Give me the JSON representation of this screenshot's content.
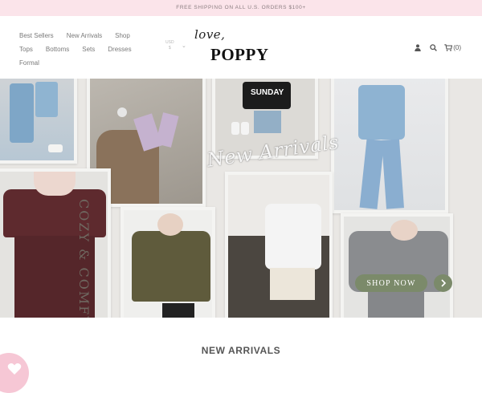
{
  "announcement": "FREE SHIPPING ON ALL U.S. ORDERS $100+",
  "nav": {
    "row1": [
      "Best Sellers",
      "New Arrivals",
      "Shop"
    ],
    "row2": [
      "Tops",
      "Bottoms",
      "Sets",
      "Dresses"
    ],
    "row3": [
      "Formal"
    ]
  },
  "currency": {
    "label": "USD",
    "value": "$"
  },
  "logo": {
    "love": "love,",
    "brand": "POPPY"
  },
  "cart": {
    "count": "(0)"
  },
  "hero": {
    "caption": "New Arrivals",
    "side_text": "COZY & COMFY",
    "cta": "SHOP NOW",
    "sweatshirt_text": "SUNDAY"
  },
  "section_title": "NEW ARRIVALS",
  "colors": {
    "announcement_bg": "#fbe4ea",
    "cta_green": "#7b8a6a",
    "heart_pink": "#f6c7d5"
  }
}
